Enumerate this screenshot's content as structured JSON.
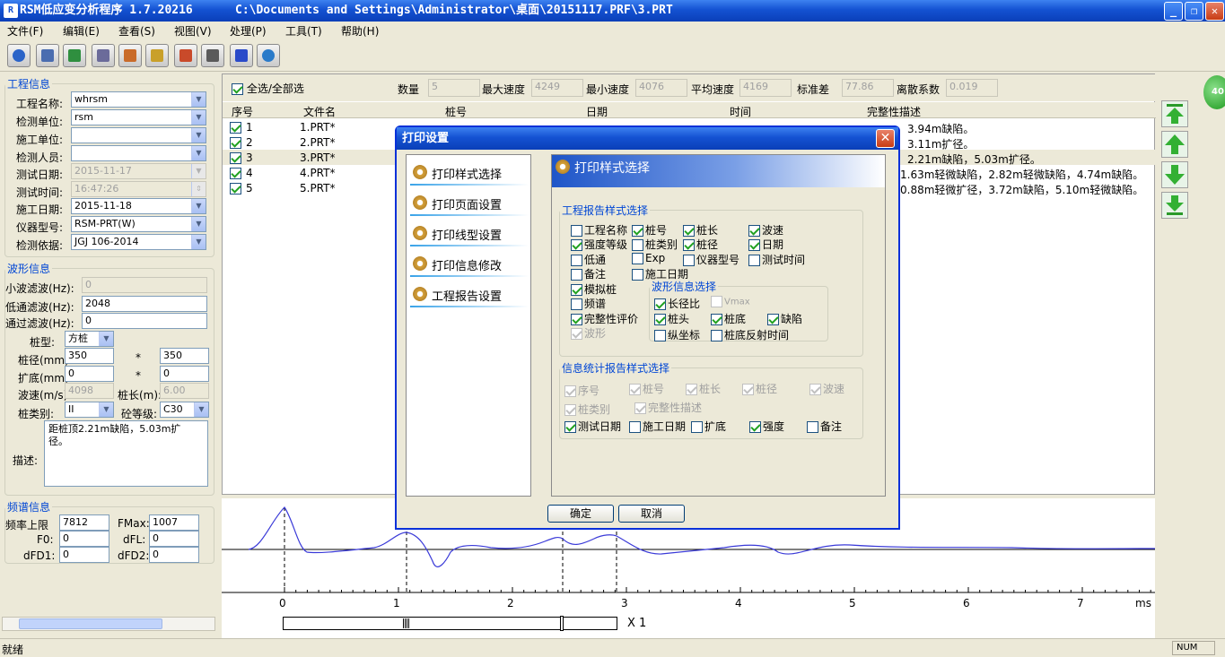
{
  "window": {
    "title": "RSM低应变分析程序 1.7.20216",
    "path": "C:\\Documents and Settings\\Administrator\\桌面\\20151117.PRF\\3.PRT"
  },
  "menu": [
    "文件(F)",
    "编辑(E)",
    "查看(S)",
    "视图(V)",
    "处理(P)",
    "工具(T)",
    "帮助(H)"
  ],
  "project": {
    "legend": "工程信息",
    "fields": [
      {
        "label": "工程名称:",
        "value": "whrsm"
      },
      {
        "label": "检测单位:",
        "value": "rsm"
      },
      {
        "label": "施工单位:",
        "value": ""
      },
      {
        "label": "检测人员:",
        "value": ""
      },
      {
        "label": "测试日期:",
        "value": "2015-11-17"
      },
      {
        "label": "测试时间:",
        "value": "16:47:26"
      },
      {
        "label": "施工日期:",
        "value": "2015-11-18"
      },
      {
        "label": "仪器型号:",
        "value": "RSM-PRT(W)"
      },
      {
        "label": "检测依据:",
        "value": "JGJ 106-2014"
      }
    ]
  },
  "wave_info": {
    "legend": "波形信息",
    "small_filter_label": "小波滤波(Hz):",
    "small_filter": "0",
    "low_filter_label": "低通滤波(Hz):",
    "low_filter": "2048",
    "band_filter_label": "通过滤波(Hz):",
    "band_filter": "0",
    "pile_type_label": "桩型:",
    "pile_type": "方桩",
    "diameter_label": "桩径(mm):",
    "diameter_a": "350",
    "diameter_b": "350",
    "bottom_label": "扩底(mm):",
    "bottom_a": "0",
    "bottom_b": "0",
    "speed_label": "波速(m/s):",
    "speed": "4098",
    "length_label": "桩长(m):",
    "length": "6.00",
    "category_label": "桩类别:",
    "category": "II",
    "grade_label": "砼等级:",
    "grade": "C30",
    "desc_label": "描述:",
    "desc": "距桩顶2.21m缺陷，5.03m扩径。",
    "times": "*"
  },
  "spectrum": {
    "legend": "频谱信息",
    "upper_label": "频率上限",
    "upper": "7812",
    "fmax_label": "FMax:",
    "fmax": "1007",
    "f0_label": "F0:",
    "f0": "0",
    "dfl_label": "dFL:",
    "dfl": "0",
    "dfd1_label": "dFD1:",
    "dfd1": "0",
    "dfd2_label": "dFD2:",
    "dfd2": "0"
  },
  "stats": {
    "select_all": "全选/全部选",
    "count_label": "数量",
    "count": "5",
    "max_label": "最大速度",
    "max": "4249",
    "min_label": "最小速度",
    "min": "4076",
    "avg_label": "平均速度",
    "avg": "4169",
    "std_label": "标准差",
    "std": "77.86",
    "cv_label": "离散系数",
    "cv": "0.019"
  },
  "table": {
    "headers": [
      "序号",
      "文件名",
      "桩号",
      "日期",
      "时间",
      "完整性描述"
    ],
    "rows": [
      {
        "no": "1",
        "file": "1.PRT*",
        "desc": "3.94m缺陷。"
      },
      {
        "no": "2",
        "file": "2.PRT*",
        "desc": "3.11m扩径。"
      },
      {
        "no": "3",
        "file": "3.PRT*",
        "desc": "2.21m缺陷，5.03m扩径。"
      },
      {
        "no": "4",
        "file": "4.PRT*",
        "desc": "1.63m轻微缺陷，2.82m轻微缺陷，4.74m缺陷。"
      },
      {
        "no": "5",
        "file": "5.PRT*",
        "desc": "0.88m轻微扩径，3.72m缺陷，5.10m轻微缺陷。"
      }
    ]
  },
  "axis": {
    "ticks": [
      "0",
      "1",
      "2",
      "3",
      "4",
      "5",
      "6",
      "7"
    ],
    "unit": "ms",
    "zoom": "X 1"
  },
  "dialog": {
    "title": "打印设置",
    "nav": [
      "打印样式选择",
      "打印页面设置",
      "打印线型设置",
      "打印信息修改",
      "工程报告设置"
    ],
    "pane_title": "打印样式选择",
    "group1": "工程报告样式选择",
    "group1_items": [
      "工程名称",
      "桩号",
      "桩长",
      "波速",
      "强度等级",
      "桩类别",
      "桩径",
      "日期",
      "低通",
      "Exp",
      "仪器型号",
      "测试时间",
      "备注",
      "施工日期",
      "模拟桩",
      "频谱",
      "完整性评价",
      "波形"
    ],
    "subgroup": "波形信息选择",
    "subgroup_items": [
      "长径比",
      "Vmax",
      "桩头",
      "桩底",
      "缺陷",
      "纵坐标",
      "桩底反射时间"
    ],
    "group2": "信息统计报告样式选择",
    "group2_items": [
      "序号",
      "桩号",
      "桩长",
      "桩径",
      "波速",
      "桩类别",
      "完整性描述",
      "测试日期",
      "施工日期",
      "扩底",
      "强度",
      "备注"
    ],
    "ok": "确定",
    "cancel": "取消"
  },
  "status": {
    "text": "就绪",
    "num": "NUM"
  },
  "badge": "40"
}
